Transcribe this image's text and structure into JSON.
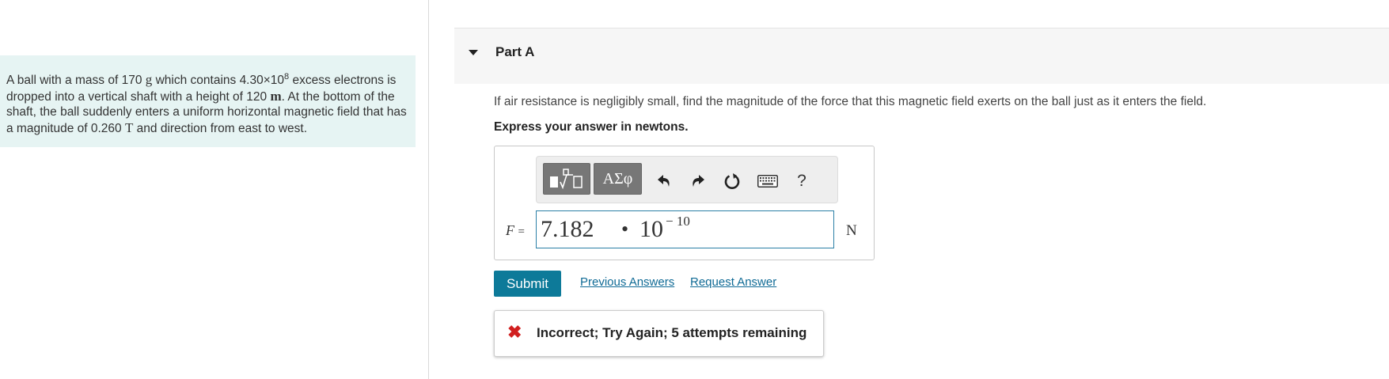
{
  "problem": {
    "part1": "A ball with a mass of 170",
    "mass_unit": "g",
    "part2": "which contains 4.30×10",
    "exponent": "8",
    "part3": "excess electrons is dropped into a vertical shaft with a height of 120",
    "height_unit": "m",
    "part4": ". At the bottom of the shaft, the ball suddenly enters a uniform horizontal magnetic field that has a magnitude of 0.260",
    "field_unit": "T",
    "part5": "and direction from east to west."
  },
  "part": {
    "title": "Part A",
    "question": "If air resistance is negligibly small, find the magnitude of the force that this magnetic field exerts on the ball just as it enters the field.",
    "instruction": "Express your answer in newtons."
  },
  "toolbar": {
    "greek_label": "ΑΣφ",
    "help_label": "?",
    "icons": [
      "templates-icon",
      "greek-symbols-icon",
      "undo-icon",
      "redo-icon",
      "reset-icon",
      "keyboard-icon",
      "help-icon"
    ]
  },
  "answer": {
    "variable": "F",
    "equals": "=",
    "mantissa": "7.182",
    "dot": "•",
    "base": "10",
    "exponent": "− 10",
    "unit": "N"
  },
  "actions": {
    "submit_label": "Submit",
    "previous_answers_label": "Previous Answers",
    "request_answer_label": "Request Answer"
  },
  "feedback": {
    "icon": "x-icon",
    "message": "Incorrect; Try Again; 5 attempts remaining"
  },
  "colors": {
    "problem_bg": "#e6f4f3",
    "submit_bg": "#0d7a99",
    "link": "#0f6a95",
    "error": "#d11f1f",
    "input_border": "#2a7fa6"
  }
}
